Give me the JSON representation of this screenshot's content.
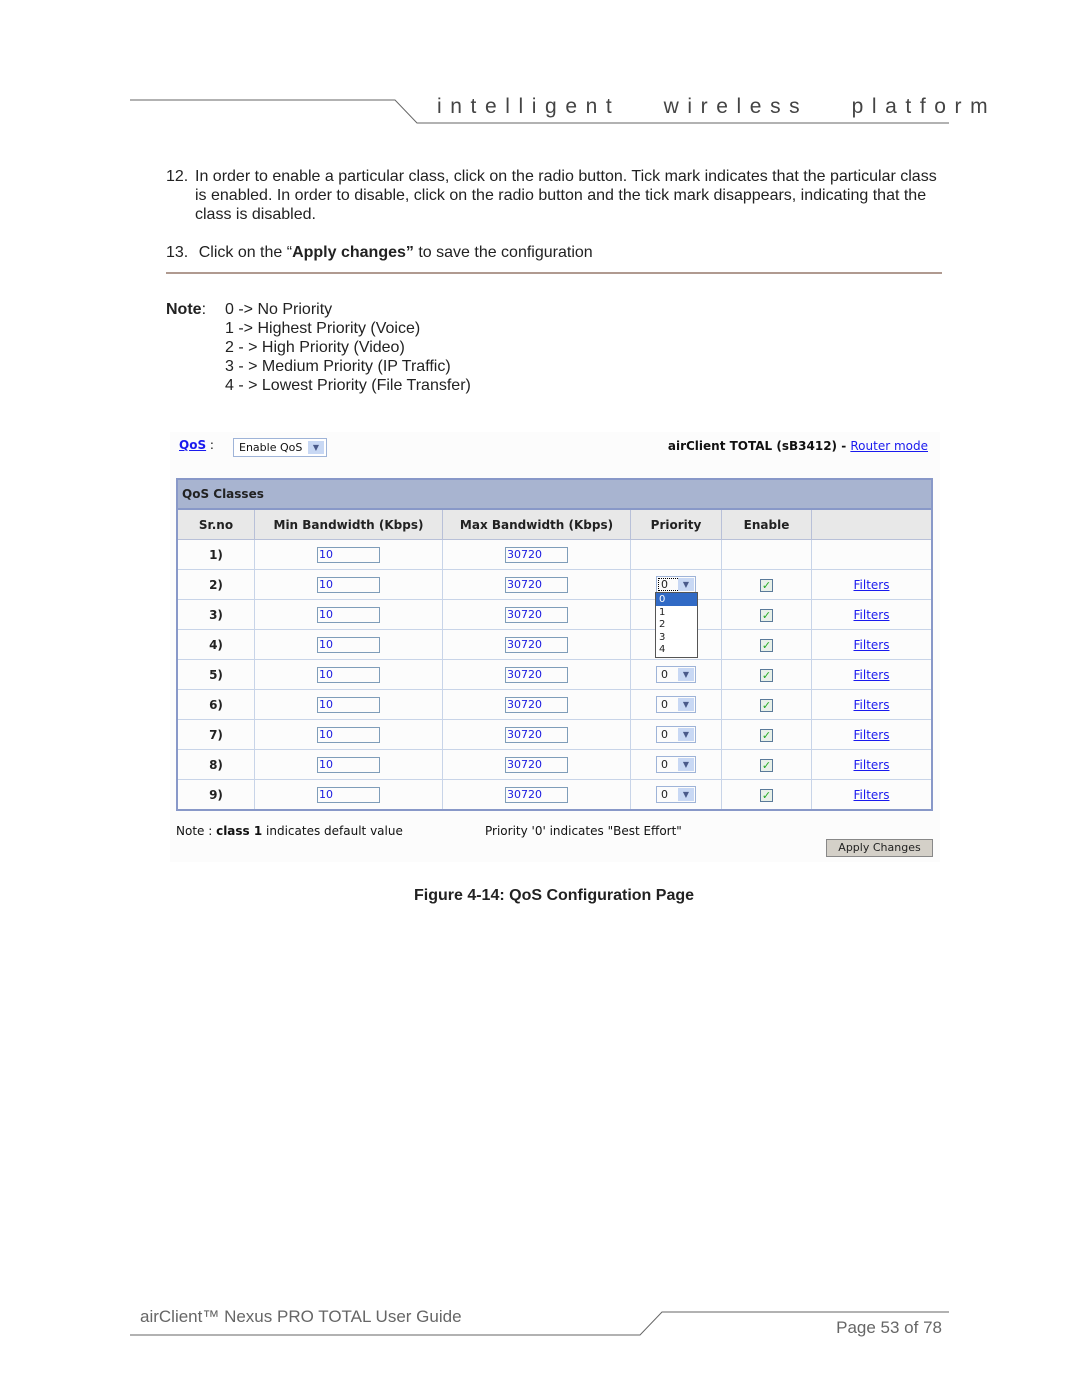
{
  "header": {
    "tagline": "intelligent   wireless   platform"
  },
  "steps": [
    {
      "num": "12.",
      "text": "In order to enable a particular class, click on the radio button. Tick mark indicates that the particular class is enabled. In order to disable, click on the radio button and the tick mark disappears, indicating that the class is disabled."
    },
    {
      "num": "13.",
      "pre": "Click on the “",
      "bold": "Apply changes”",
      "post": " to save the configuration"
    }
  ],
  "note": {
    "label": "Note",
    "lines": [
      "0 -> No Priority",
      "1 -> Highest Priority (Voice)",
      "2 - > High Priority (Video)",
      "3 - > Medium Priority (IP Traffic)",
      "4 - > Lowest Priority (File Transfer)"
    ]
  },
  "qos_ui": {
    "qos_link": "QoS",
    "qos_select": "Enable QoS",
    "device": "airClient TOTAL (sB3412) - ",
    "mode_link": "Router mode",
    "table_title": "QoS Classes",
    "columns": [
      "Sr.no",
      "Min Bandwidth (Kbps)",
      "Max Bandwidth (Kbps)",
      "Priority",
      "Enable",
      ""
    ],
    "rows": [
      {
        "sr": "1)",
        "min": "10",
        "max": "30720"
      },
      {
        "sr": "2)",
        "min": "10",
        "max": "30720",
        "priority": "0",
        "enabled": true,
        "filters": "Filters"
      },
      {
        "sr": "3)",
        "min": "10",
        "max": "30720",
        "enabled": true,
        "filters": "Filters"
      },
      {
        "sr": "4)",
        "min": "10",
        "max": "30720",
        "enabled": true,
        "filters": "Filters"
      },
      {
        "sr": "5)",
        "min": "10",
        "max": "30720",
        "priority": "0",
        "enabled": true,
        "filters": "Filters"
      },
      {
        "sr": "6)",
        "min": "10",
        "max": "30720",
        "priority": "0",
        "enabled": true,
        "filters": "Filters"
      },
      {
        "sr": "7)",
        "min": "10",
        "max": "30720",
        "priority": "0",
        "enabled": true,
        "filters": "Filters"
      },
      {
        "sr": "8)",
        "min": "10",
        "max": "30720",
        "priority": "0",
        "enabled": true,
        "filters": "Filters"
      },
      {
        "sr": "9)",
        "min": "10",
        "max": "30720",
        "priority": "0",
        "enabled": true,
        "filters": "Filters"
      }
    ],
    "priority_options": [
      "0",
      "1",
      "2",
      "3",
      "4"
    ],
    "note_pre": "Note : ",
    "note_bold": "class 1",
    "note_post": " indicates default value",
    "priority_note": "Priority '0' indicates \"Best Effort\"",
    "apply_button": "Apply Changes"
  },
  "caption": "Figure 4-14: QoS Configuration Page",
  "footer": {
    "title": "airClient™ Nexus PRO TOTAL User Guide",
    "page": "Page 53 of 78"
  }
}
